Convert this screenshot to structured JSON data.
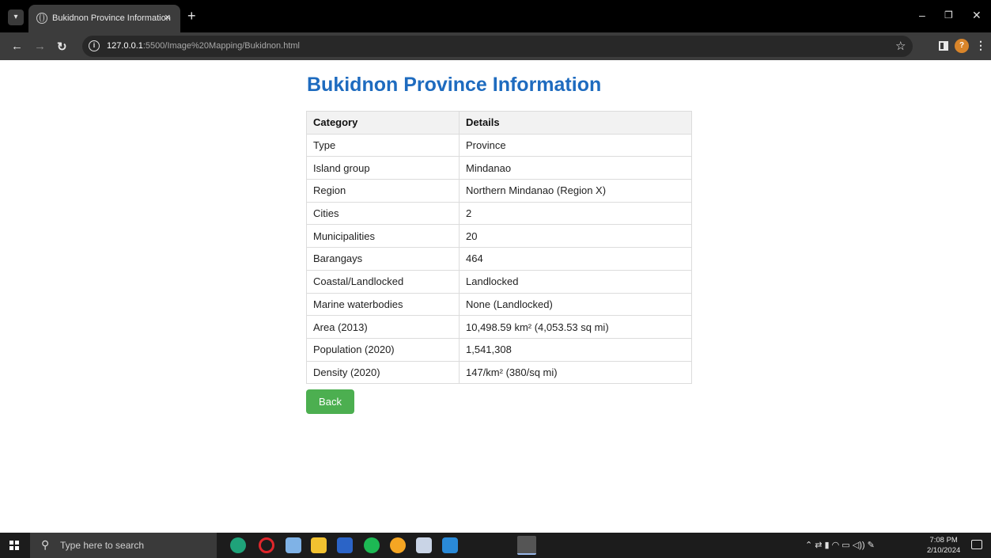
{
  "browser": {
    "tab_title": "Bukidnon Province Information",
    "tab_close": "×",
    "new_tab": "+",
    "url_host": "127.0.0.1",
    "url_path": ":5500/Image%20Mapping/Bukidnon.html"
  },
  "page": {
    "title": "Bukidnon Province Information",
    "table": {
      "headers": [
        "Category",
        "Details"
      ],
      "rows": [
        [
          "Type",
          "Province"
        ],
        [
          "Island group",
          "Mindanao"
        ],
        [
          "Region",
          "Northern Mindanao (Region X)"
        ],
        [
          "Cities",
          "2"
        ],
        [
          "Municipalities",
          "20"
        ],
        [
          "Barangays",
          "464"
        ],
        [
          "Coastal/Landlocked",
          "Landlocked"
        ],
        [
          "Marine waterbodies",
          "None (Landlocked)"
        ],
        [
          "Area (2013)",
          "10,498.59 km² (4,053.53 sq mi)"
        ],
        [
          "Population (2020)",
          "1,541,308"
        ],
        [
          "Density (2020)",
          "147/km² (380/sq mi)"
        ]
      ]
    },
    "back_label": "Back"
  },
  "taskbar": {
    "search_placeholder": "Type here to search",
    "time": "7:08 PM",
    "date": "2/10/2024"
  },
  "colors": {
    "title": "#1e6bbf",
    "back_button": "#4caf50"
  }
}
